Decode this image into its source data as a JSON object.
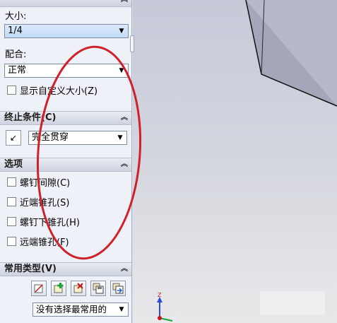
{
  "panel": {
    "top_header": "",
    "size_label": "大小:",
    "size_value": "1/4",
    "fit_label": "配合:",
    "fit_value": "正常",
    "custom_size": {
      "label": "显示自定义大小(Z)",
      "checked": false
    }
  },
  "end_condition": {
    "header": "终止条件(C)",
    "value": "完全贯穿"
  },
  "options": {
    "header": "选项",
    "items": [
      {
        "label": "螺钉间隙(C)",
        "checked": false
      },
      {
        "label": "近端锥孔(S)",
        "checked": false
      },
      {
        "label": "螺钉下锥孔(H)",
        "checked": false
      },
      {
        "label": "远端锥孔(F)",
        "checked": false
      }
    ]
  },
  "favorites": {
    "header": "常用类型(V)",
    "toolbar_icons": [
      "no-favorite-icon",
      "add-favorite-icon",
      "delete-favorite-icon",
      "save-favorite-icon",
      "load-favorite-icon"
    ],
    "value": "没有选择最常用的"
  },
  "colors": {
    "annotation": "#d0202a",
    "panel_bg": "#eef1f8",
    "highlight": "#c3dbf7",
    "model_face": "#a9adbf"
  }
}
